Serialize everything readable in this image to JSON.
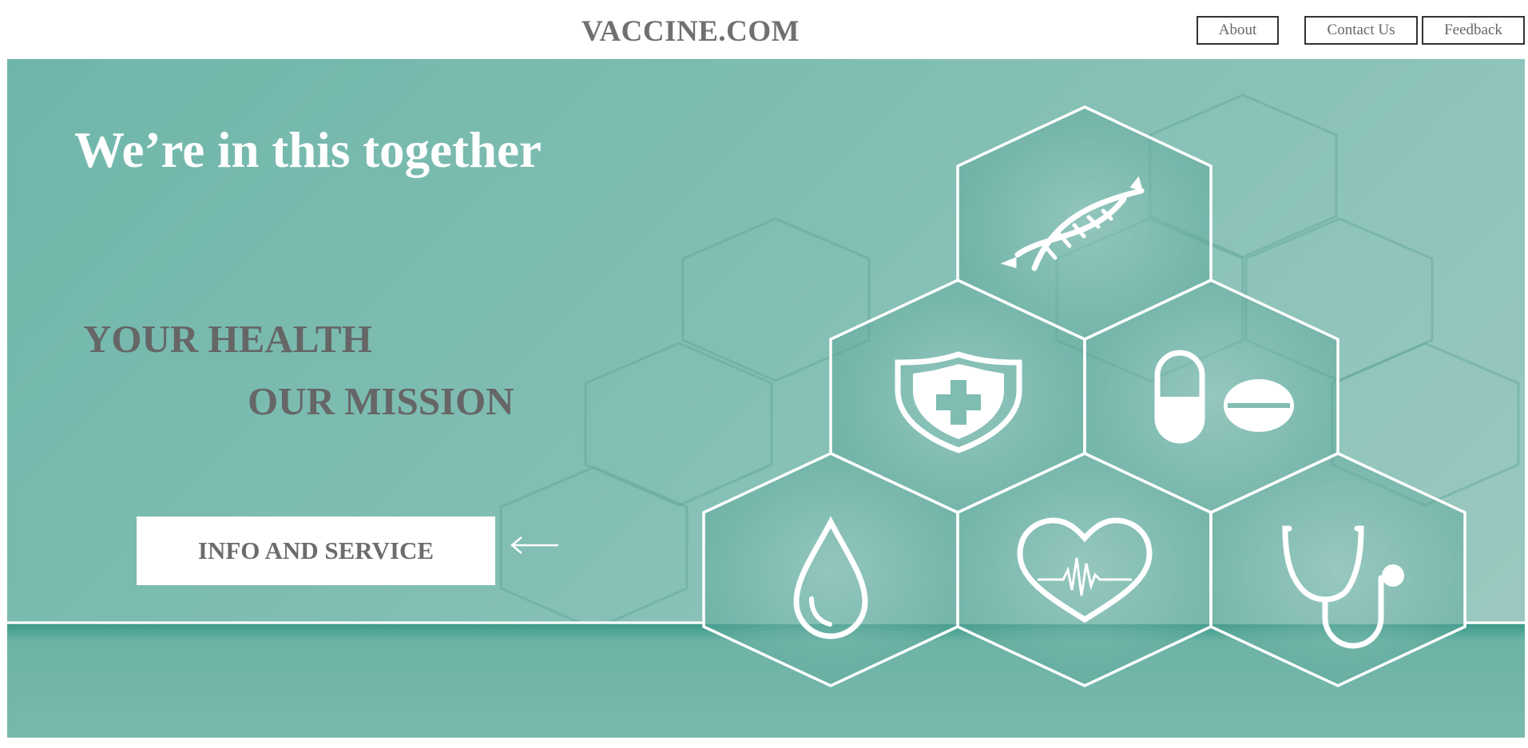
{
  "header": {
    "title": "VACCINE.COM",
    "nav": [
      {
        "label": "About"
      },
      {
        "label": "Contact Us"
      },
      {
        "label": "Feedback"
      }
    ]
  },
  "hero": {
    "tagline": "We’re in this together",
    "mission_line1": "YOUR HEALTH",
    "mission_line2": "OUR MISSION",
    "cta_label": "INFO AND SERVICE",
    "arrow_icon": "arrow-left-icon",
    "icons": [
      "dna-icon",
      "shield-plus-icon",
      "pills-icon",
      "blood-drop-icon",
      "heartbeat-icon",
      "stethoscope-icon"
    ]
  },
  "colors": {
    "hero_bg": "#80bdb2",
    "heading_white": "#ffffff",
    "mission_gray": "#666666",
    "nav_text": "#666666"
  }
}
